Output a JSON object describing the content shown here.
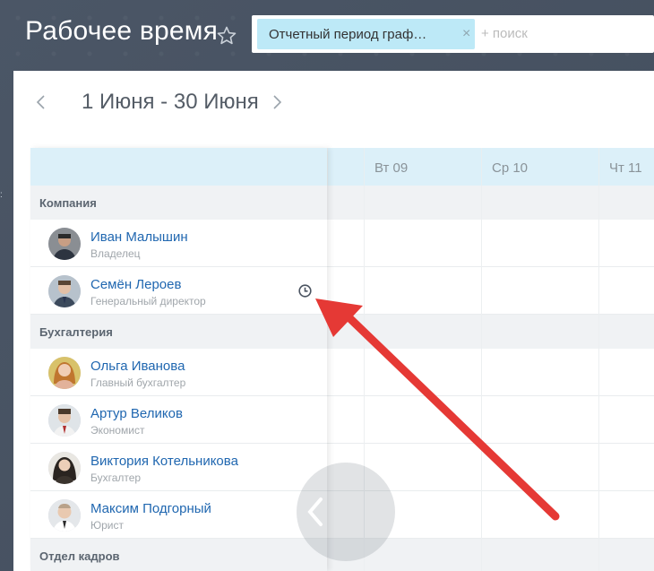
{
  "header": {
    "title": "Рабочее время",
    "filter_chip": "Отчетный период граф…",
    "search_add": "+ поиск"
  },
  "calendar": {
    "date_range": "1 Июня - 30 Июня",
    "days": [
      "Вт 09",
      "Ср 10",
      "Чт 11"
    ]
  },
  "groups": [
    {
      "name": "Компания",
      "people": [
        {
          "name": "Иван Малышин",
          "role": "Владелец"
        },
        {
          "name": "Семён Лероев",
          "role": "Генеральный директор"
        }
      ]
    },
    {
      "name": "Бухгалтерия",
      "people": [
        {
          "name": "Ольга Иванова",
          "role": "Главный бухгалтер"
        },
        {
          "name": "Артур Великов",
          "role": "Экономист"
        },
        {
          "name": "Виктория Котельникова",
          "role": "Бухгалтер"
        },
        {
          "name": "Максим Подгорный",
          "role": "Юрист"
        }
      ]
    },
    {
      "name": "Отдел кадров",
      "people": []
    }
  ],
  "colors": {
    "accent_arrow": "#e53935",
    "header_row": "#dcf0f9",
    "link": "#2067b0",
    "chip": "#bde9f7"
  }
}
